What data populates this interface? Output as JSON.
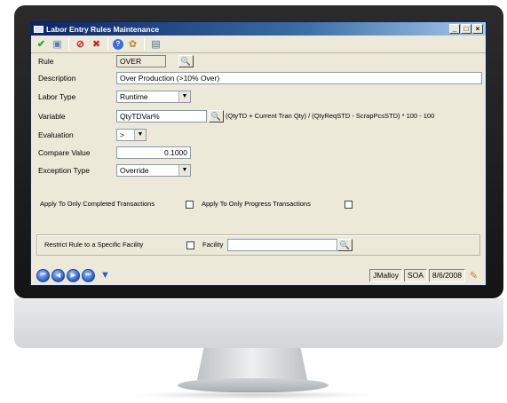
{
  "window": {
    "title": "Labor Entry Rules Maintenance",
    "min_glyph": "_",
    "max_glyph": "□",
    "close_glyph": "×"
  },
  "toolbar": {
    "save_glyph": "✔",
    "disk_glyph": "▣",
    "delete_glyph": "⊘",
    "cancel_glyph": "✖",
    "help_glyph": "?",
    "tool_glyph": "✿",
    "print_glyph": "▤"
  },
  "form": {
    "rule_label": "Rule",
    "rule_value": "OVER",
    "description_label": "Description",
    "description_value": "Over Production (>10% Over)",
    "labor_type_label": "Labor Type",
    "labor_type_value": "Runtime",
    "variable_label": "Variable",
    "variable_value": "QtyTDVar%",
    "variable_formula": "(QtyTD + Current Tran Qty) / (QtyReqSTD - ScrapPcsSTD) * 100 - 100",
    "evaluation_label": "Evaluation",
    "evaluation_value": ">",
    "compare_value_label": "Compare Value",
    "compare_value": "0.1000",
    "exception_type_label": "Exception Type",
    "exception_type_value": "Override",
    "apply_completed_label": "Apply To Only Completed Transactions",
    "apply_progress_label": "Apply To Only Progress Transactions",
    "restrict_label": "Restrict Rule to a Specific Facility",
    "facility_label": "Facility",
    "facility_value": "",
    "combo_arrow": "▼",
    "lookup_glyph": "🔍"
  },
  "statusbar": {
    "nav_first": "⏮",
    "nav_prev": "◀",
    "nav_next": "▶",
    "nav_last": "⏭",
    "filter_glyph": "▼",
    "user": "JMalloy",
    "company": "SOA",
    "date": "8/6/2008",
    "edit_glyph": "✎"
  },
  "colors": {
    "titlebar": "#0a246a",
    "window_bg": "#ece9d8",
    "accent_green": "#2e9e2e",
    "accent_red": "#d02020"
  }
}
